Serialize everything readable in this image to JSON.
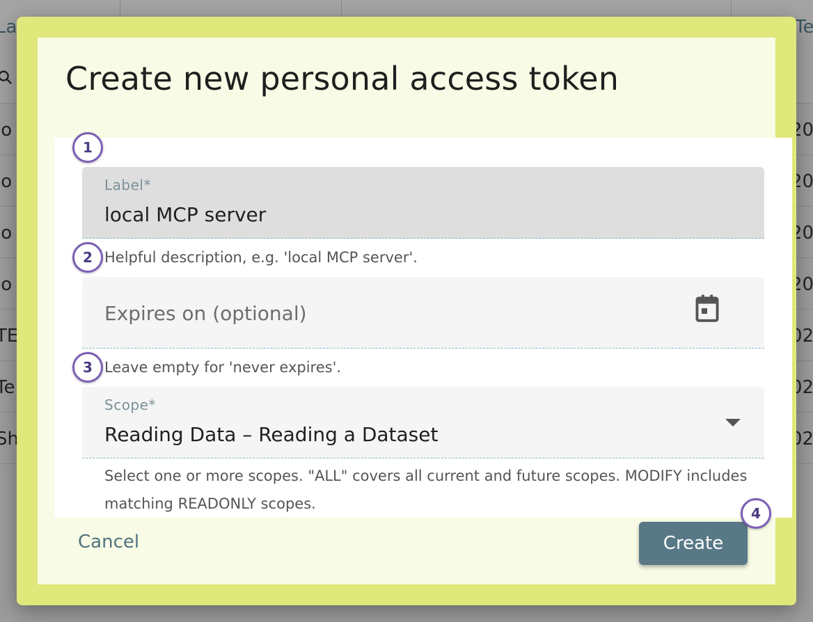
{
  "background": {
    "header_left": "La",
    "header_right": "Te",
    "rows": [
      {
        "left": "lo",
        "right": "20"
      },
      {
        "left": "lo",
        "right": "20"
      },
      {
        "left": "lo",
        "right": "20"
      },
      {
        "left": "lo",
        "right": "20"
      },
      {
        "left": "TE",
        "right": "02"
      },
      {
        "left": "Te",
        "right": "02"
      },
      {
        "left": "Sh",
        "right": "02"
      }
    ]
  },
  "dialog": {
    "title": "Create new personal access token",
    "label_field": {
      "step": "1",
      "label": "Label*",
      "value": "local MCP server",
      "helper": "Helpful description, e.g. 'local MCP server'."
    },
    "expires_field": {
      "step": "2",
      "placeholder": "Expires on (optional)",
      "helper": "Leave empty for 'never expires'."
    },
    "scope_field": {
      "step": "3",
      "label": "Scope*",
      "value": "Reading Data – Reading a Dataset",
      "helper": "Select one or more scopes. \"ALL\" covers all current and future scopes. MODIFY includes matching READONLY scopes."
    },
    "cancel_label": "Cancel",
    "create_label": "Create",
    "create_step": "4"
  },
  "colors": {
    "dialog_frame": "#dfe87a",
    "dialog_inner": "#f8fbe5",
    "primary_button": "#587886",
    "step_badge": "#7b5fb5"
  },
  "icons": {
    "calendar": "calendar-icon",
    "dropdown": "chevron-down-icon",
    "search": "search-icon"
  }
}
